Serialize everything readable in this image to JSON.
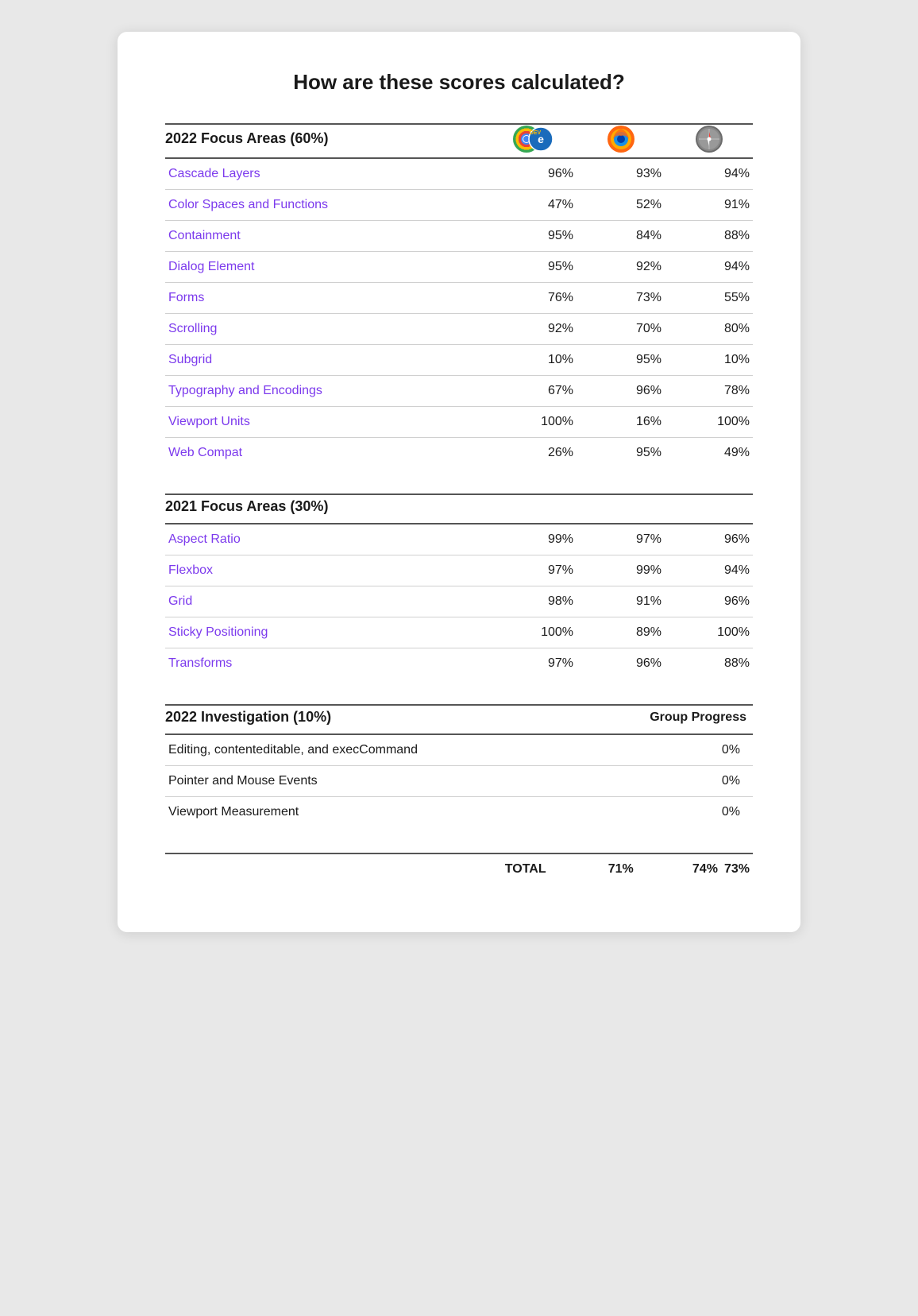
{
  "title": "How are these scores calculated?",
  "section2022": {
    "label": "2022 Focus Areas (60%)",
    "browsers": [
      "Chrome/Edge Dev",
      "Firefox",
      "Safari"
    ],
    "items": [
      {
        "name": "Cascade Layers",
        "scores": [
          "96%",
          "93%",
          "94%"
        ]
      },
      {
        "name": "Color Spaces and Functions",
        "scores": [
          "47%",
          "52%",
          "91%"
        ]
      },
      {
        "name": "Containment",
        "scores": [
          "95%",
          "84%",
          "88%"
        ]
      },
      {
        "name": "Dialog Element",
        "scores": [
          "95%",
          "92%",
          "94%"
        ]
      },
      {
        "name": "Forms",
        "scores": [
          "76%",
          "73%",
          "55%"
        ]
      },
      {
        "name": "Scrolling",
        "scores": [
          "92%",
          "70%",
          "80%"
        ]
      },
      {
        "name": "Subgrid",
        "scores": [
          "10%",
          "95%",
          "10%"
        ]
      },
      {
        "name": "Typography and Encodings",
        "scores": [
          "67%",
          "96%",
          "78%"
        ]
      },
      {
        "name": "Viewport Units",
        "scores": [
          "100%",
          "16%",
          "100%"
        ]
      },
      {
        "name": "Web Compat",
        "scores": [
          "26%",
          "95%",
          "49%"
        ]
      }
    ]
  },
  "section2021": {
    "label": "2021 Focus Areas (30%)",
    "items": [
      {
        "name": "Aspect Ratio",
        "scores": [
          "99%",
          "97%",
          "96%"
        ]
      },
      {
        "name": "Flexbox",
        "scores": [
          "97%",
          "99%",
          "94%"
        ]
      },
      {
        "name": "Grid",
        "scores": [
          "98%",
          "91%",
          "96%"
        ]
      },
      {
        "name": "Sticky Positioning",
        "scores": [
          "100%",
          "89%",
          "100%"
        ]
      },
      {
        "name": "Transforms",
        "scores": [
          "97%",
          "96%",
          "88%"
        ]
      }
    ]
  },
  "section2022inv": {
    "label": "2022 Investigation (10%)",
    "groupProgressLabel": "Group Progress",
    "items": [
      {
        "name": "Editing, contenteditable, and execCommand",
        "score": "0%"
      },
      {
        "name": "Pointer and Mouse Events",
        "score": "0%"
      },
      {
        "name": "Viewport Measurement",
        "score": "0%"
      }
    ]
  },
  "total": {
    "label": "TOTAL",
    "scores": [
      "71%",
      "74%",
      "73%"
    ]
  }
}
